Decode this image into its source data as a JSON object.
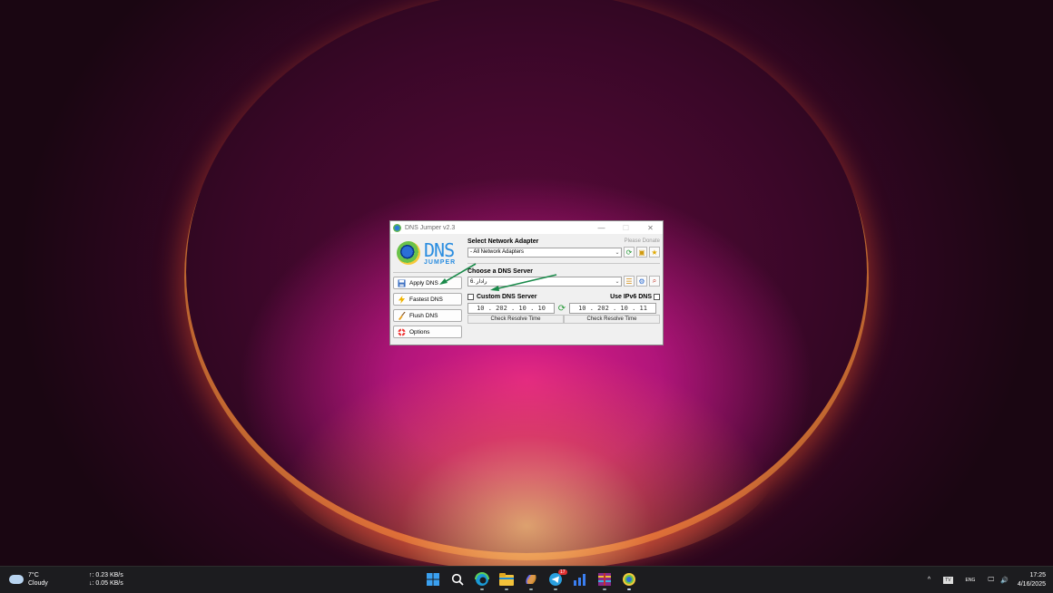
{
  "window": {
    "title": "DNS Jumper v2.3",
    "minimize": "—",
    "maximize": "☐",
    "close": "✕"
  },
  "logo": {
    "dns": "DNS",
    "jumper": "JUMPER"
  },
  "left_buttons": [
    {
      "label": "Apply DNS",
      "icon": "floppy-icon"
    },
    {
      "label": "Fastest DNS",
      "icon": "lightning-icon"
    },
    {
      "label": "Flush DNS",
      "icon": "broom-icon"
    },
    {
      "label": "Options",
      "icon": "lifebuoy-icon"
    }
  ],
  "adapter": {
    "label": "Select Network Adapter",
    "donate": "Please Donate",
    "selected": "- All Network Adapters"
  },
  "dns_server": {
    "label": "Choose a DNS Server",
    "selected": "6. رادار"
  },
  "custom": {
    "label": "Custom DNS Server",
    "ipv6_label": "Use IPv6 DNS",
    "primary": "10 . 202 . 10 . 10",
    "secondary": "10 . 202 . 10 . 11",
    "check_primary": "Check Resolve Time",
    "check_secondary": "Check Resolve Time"
  },
  "taskbar": {
    "temp": "7°C",
    "condition": "Cloudy",
    "upload": "↑: 0.23 KB/s",
    "download": "↓: 0.05 KB/s",
    "tray_lang": "ENG",
    "time": "17:25",
    "date": "4/16/2025",
    "badge": "17"
  },
  "colors": {
    "arrow": "#1a8a4a",
    "accent": "#2a8de0",
    "taskbar": "#1c1c1f"
  }
}
